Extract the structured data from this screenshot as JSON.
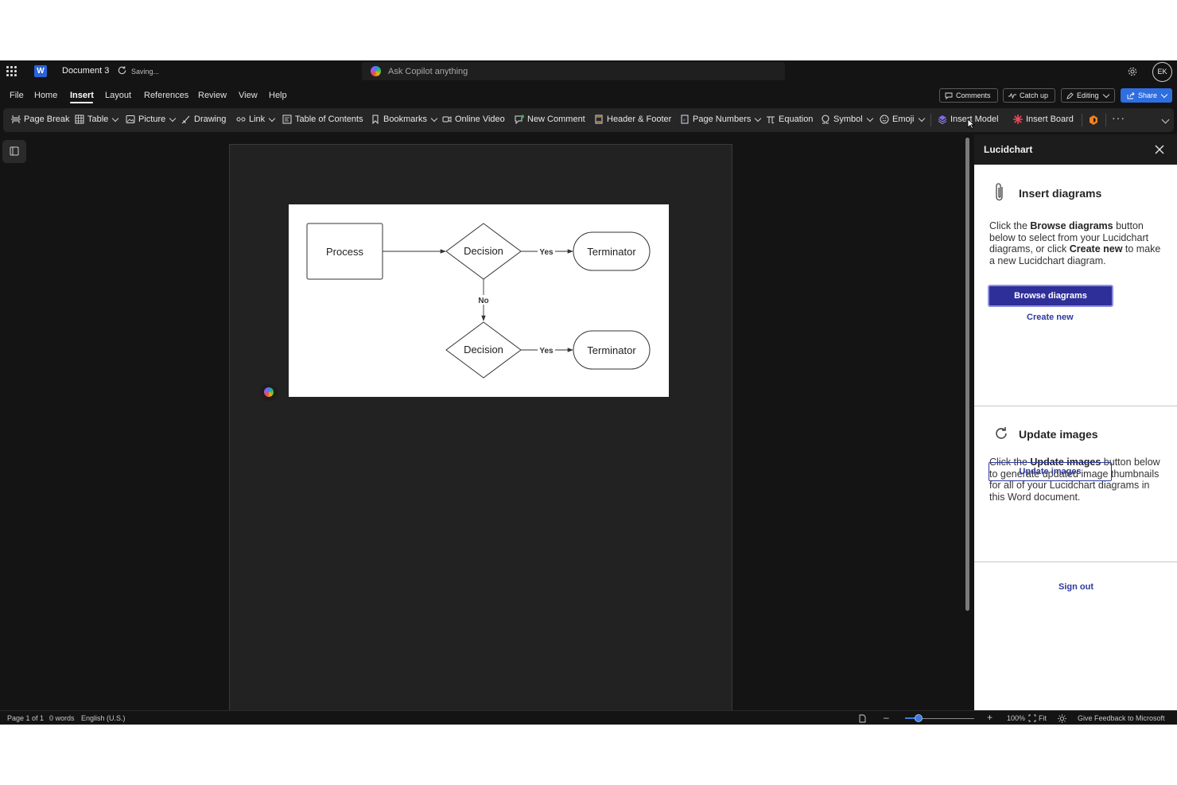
{
  "app": {
    "doc_title": "Document 3",
    "save_status": "Saving...",
    "copilot_placeholder": "Ask Copilot anything",
    "avatar_initials": "EK",
    "accent": "#2f6ee0"
  },
  "menu": {
    "file": "File",
    "home": "Home",
    "insert": "Insert",
    "layout": "Layout",
    "references": "References",
    "review": "Review",
    "view": "View",
    "help": "Help",
    "active": "Insert"
  },
  "top_actions": {
    "comments": "Comments",
    "catch_up": "Catch up",
    "editing": "Editing",
    "share": "Share"
  },
  "ribbon": {
    "page_break": "Page Break",
    "table": "Table",
    "picture": "Picture",
    "drawing": "Drawing",
    "link": "Link",
    "toc": "Table of Contents",
    "bookmarks": "Bookmarks",
    "online_video": "Online Video",
    "new_comment": "New Comment",
    "header_footer": "Header & Footer",
    "page_numbers": "Page Numbers",
    "equation": "Equation",
    "symbol": "Symbol",
    "emoji": "Emoji",
    "insert_model": "Insert Model",
    "insert_board": "Insert Board",
    "more": "···"
  },
  "diagram": {
    "process": "Process",
    "decision_1": "Decision",
    "decision_2": "Decision",
    "terminator_1": "Terminator",
    "terminator_2": "Terminator",
    "yes_1": "Yes",
    "yes_2": "Yes",
    "no": "No"
  },
  "panel": {
    "title": "Lucidchart",
    "insert_title": "Insert diagrams",
    "insert_desc_1": "Click the ",
    "insert_desc_b1": "Browse diagrams",
    "insert_desc_2": " button below to select from your Lucidchart diagrams, or click ",
    "insert_desc_b2": "Create new",
    "insert_desc_3": " to make a new Lucidchart diagram.",
    "browse_button": "Browse diagrams",
    "create_new": "Create new",
    "update_title": "Update images",
    "update_desc_1": "Click the ",
    "update_desc_b1": "Update images",
    "update_desc_2": " button below to generate updated image thumbnails for all of your Lucidchart diagrams in this Word document.",
    "update_button": "Update images",
    "sign_out": "Sign out"
  },
  "status": {
    "page": "Page 1 of 1",
    "words": "0 words",
    "language": "English (U.S.)",
    "zoom_percent": "100%",
    "fit": "Fit",
    "feedback": "Give Feedback to Microsoft",
    "zoom_level": 0.2
  }
}
